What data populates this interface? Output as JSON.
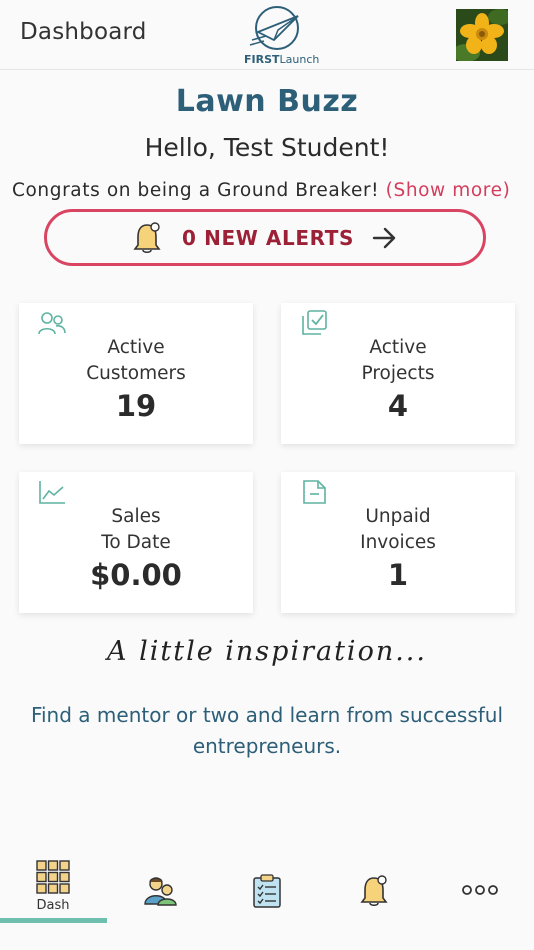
{
  "header": {
    "title": "Dashboard",
    "logo_text_bold": "FIRST",
    "logo_text_light": "Launch"
  },
  "business_name": "Lawn Buzz",
  "greeting": "Hello, Test Student!",
  "congrats": {
    "text": "Congrats on being a Ground Breaker!",
    "link": "(Show more)"
  },
  "alerts": {
    "label": "0 NEW ALERTS"
  },
  "stats": [
    {
      "label_line1": "Active",
      "label_line2": "Customers",
      "value": "19",
      "icon": "people-icon"
    },
    {
      "label_line1": "Active",
      "label_line2": "Projects",
      "value": "4",
      "icon": "checklist-icon"
    },
    {
      "label_line1": "Sales",
      "label_line2": "To Date",
      "value": "$0.00",
      "icon": "line-chart-icon"
    },
    {
      "label_line1": "Unpaid",
      "label_line2": "Invoices",
      "value": "1",
      "icon": "document-icon"
    }
  ],
  "inspiration": {
    "title": "A little inspiration...",
    "text": "Find a mentor or two and learn from successful entrepreneurs."
  },
  "tabbar": {
    "tabs": [
      {
        "label": "Dash",
        "icon": "grid-icon",
        "active": true
      },
      {
        "label": "",
        "icon": "customers-icon"
      },
      {
        "label": "",
        "icon": "clipboard-icon"
      },
      {
        "label": "",
        "icon": "bell-icon"
      },
      {
        "label": "",
        "icon": "more-icon"
      }
    ]
  },
  "colors": {
    "brand_blue": "#2d5f78",
    "alert_red": "#d94462",
    "accent_teal": "#6fbfae"
  }
}
